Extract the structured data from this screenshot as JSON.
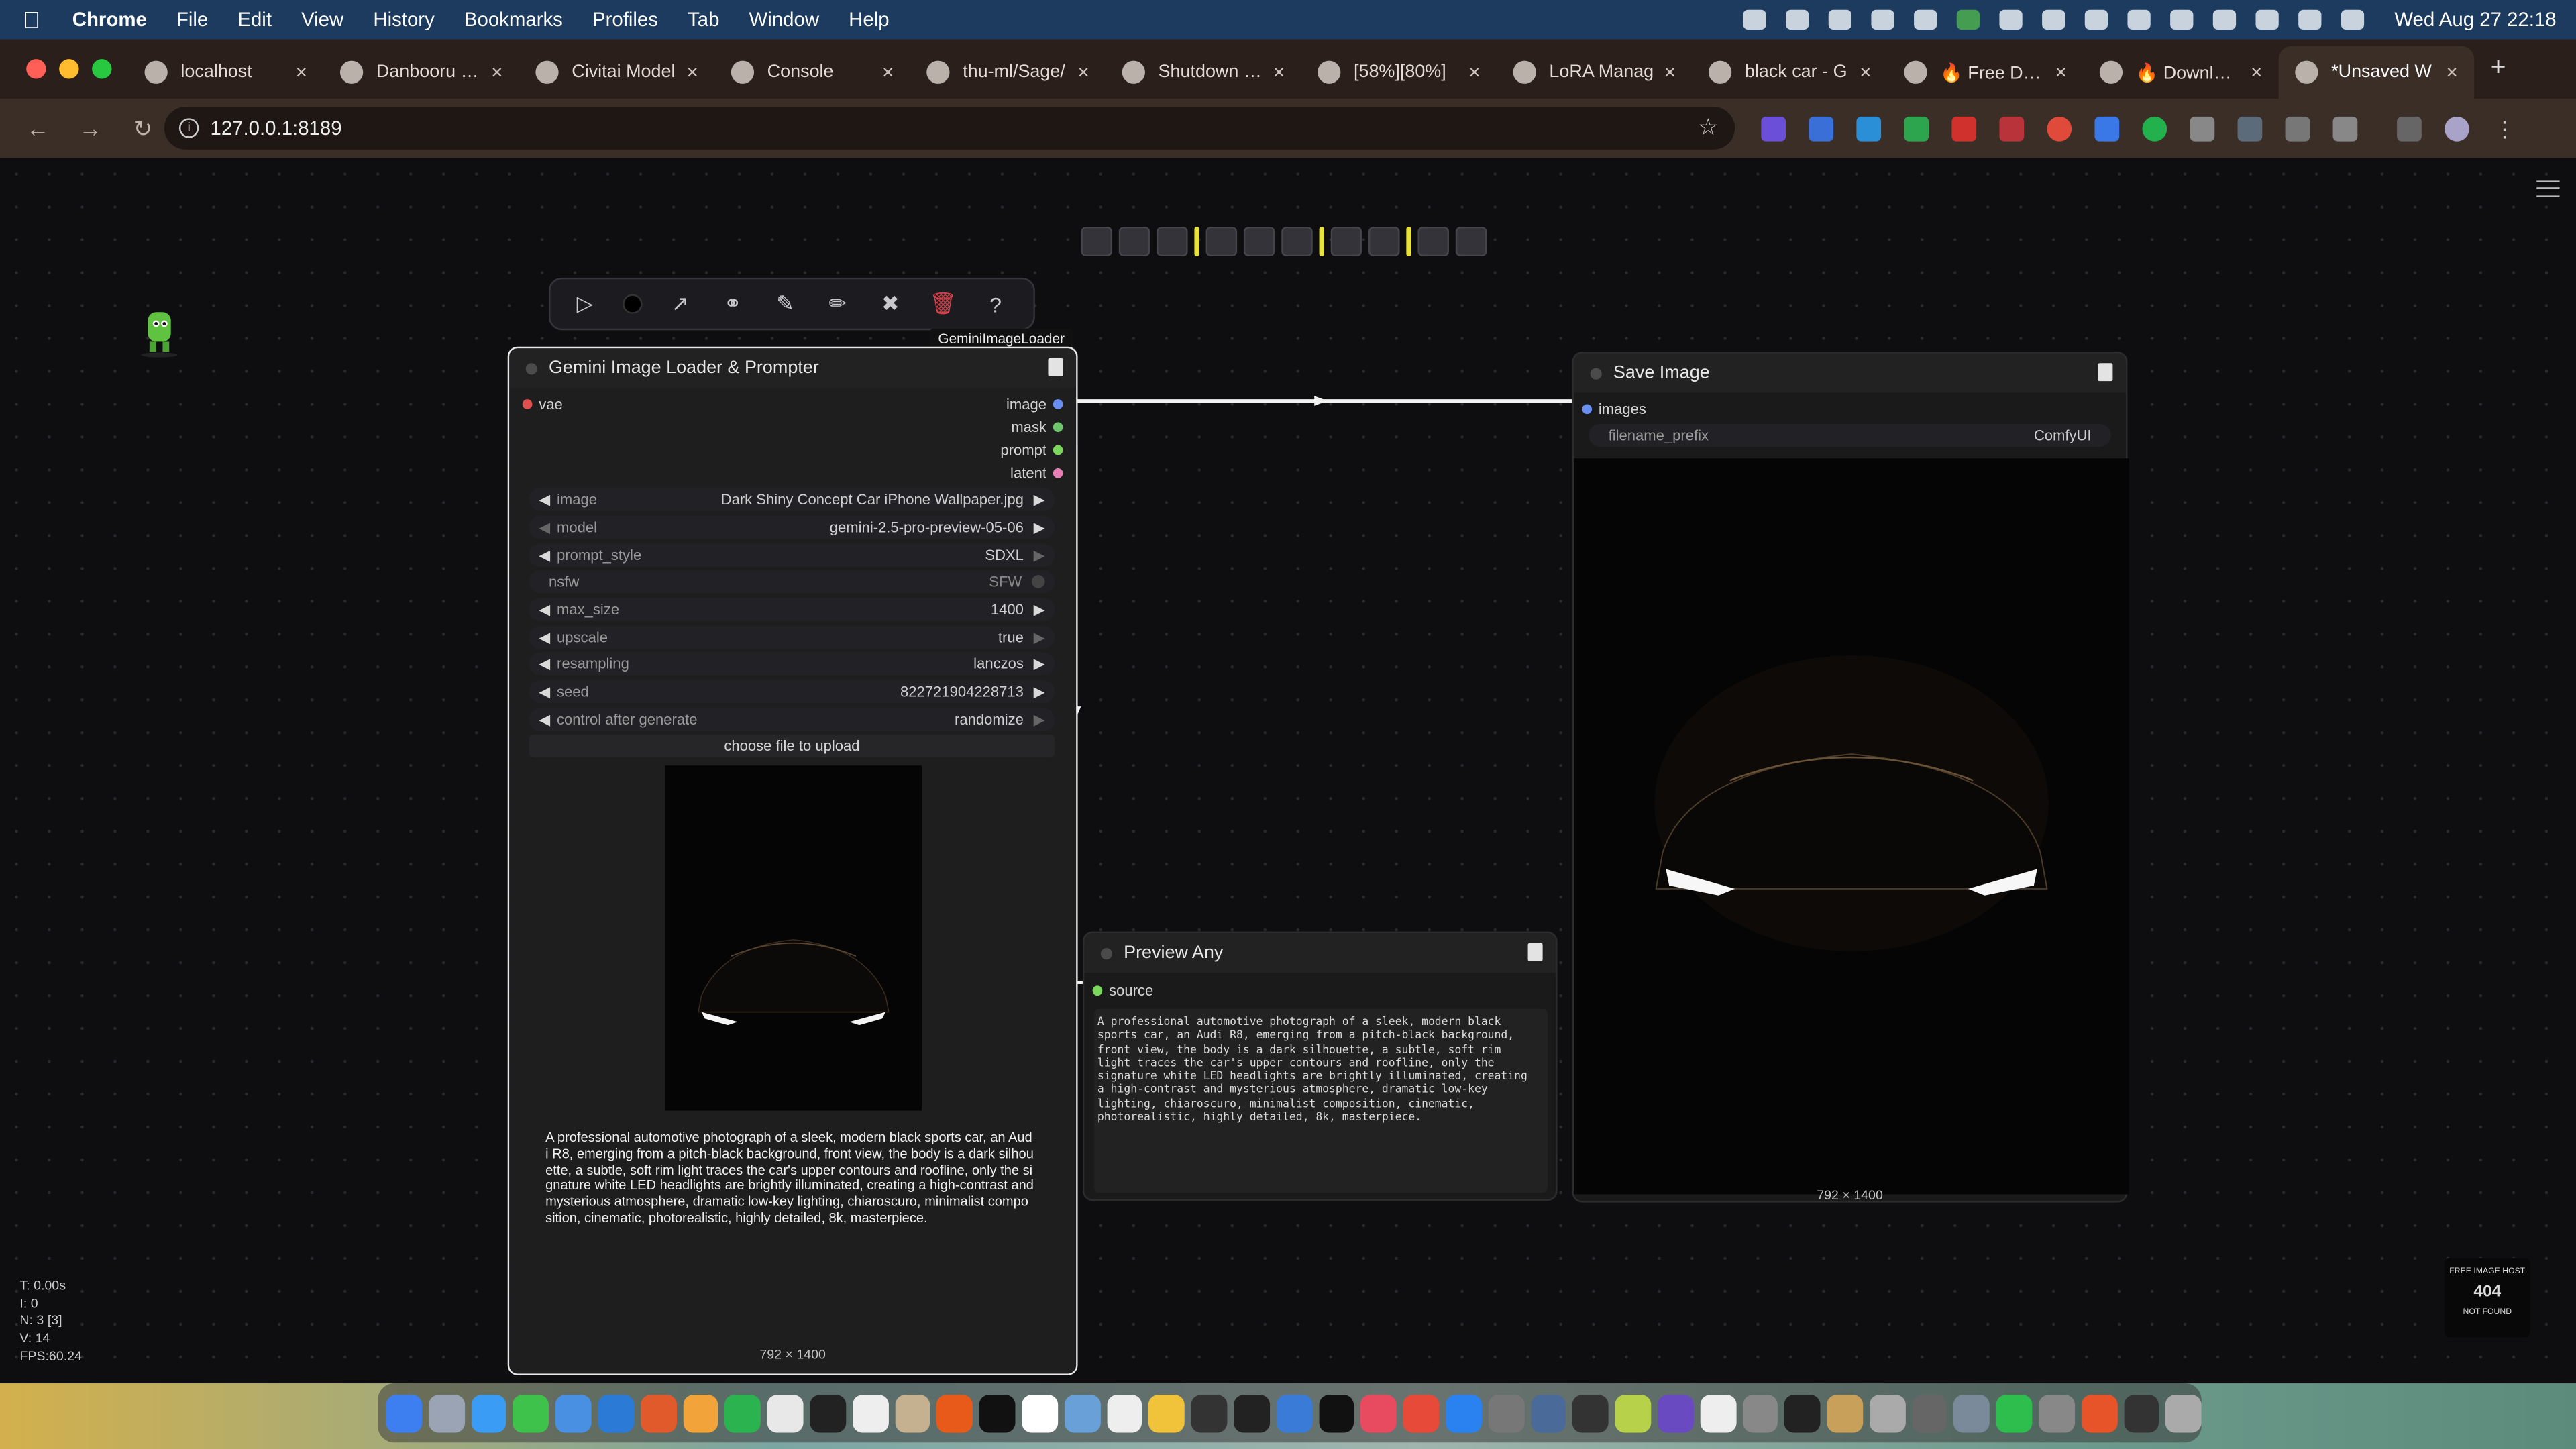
{
  "menubar": {
    "app": "Chrome",
    "items": [
      "File",
      "Edit",
      "View",
      "History",
      "Bookmarks",
      "Profiles",
      "Tab",
      "Window",
      "Help"
    ],
    "clock": "Wed Aug 27  22:18"
  },
  "tabs": [
    {
      "title": "localhost",
      "fav": "globe-icon"
    },
    {
      "title": "Danbooru Po",
      "fav": "danbooru-icon"
    },
    {
      "title": "Civitai Model",
      "fav": "civitai-icon"
    },
    {
      "title": "Console",
      "fav": "n-icon"
    },
    {
      "title": "thu-ml/Sage/",
      "fav": "github-icon"
    },
    {
      "title": "Shutdown bo",
      "fav": "openai-icon"
    },
    {
      "title": "[58%][80%]",
      "fav": "comfy-icon"
    },
    {
      "title": "LoRA Manag",
      "fav": "l-icon"
    },
    {
      "title": "black car - G",
      "fav": "google-icon"
    },
    {
      "title": "🔥 Free Dow",
      "fav": "firefox-icon"
    },
    {
      "title": "🔥 Download",
      "fav": "firefox-icon"
    },
    {
      "title": "*Unsaved W",
      "fav": "comfy-icon",
      "active": true
    }
  ],
  "address": {
    "url": "127.0.0.1:8189"
  },
  "selection_badge": "GeminiImageLoader",
  "nodes": {
    "gemini": {
      "title": "Gemini Image Loader & Prompter",
      "input": "vae",
      "outputs": [
        "image",
        "mask",
        "prompt",
        "latent"
      ],
      "widgets": [
        {
          "name": "image",
          "value": "Dark Shiny Concept Car iPhone Wallpaper.jpg",
          "dim": false
        },
        {
          "name": "model",
          "value": "gemini-2.5-pro-preview-05-06",
          "dim": true
        },
        {
          "name": "prompt_style",
          "value": "SDXL",
          "dim": false
        },
        {
          "name": "nsfw",
          "value": "SFW",
          "dim": true,
          "toggle": true
        },
        {
          "name": "max_size",
          "value": "1400",
          "dim": false
        },
        {
          "name": "upscale",
          "value": "true",
          "dim": false
        },
        {
          "name": "resampling",
          "value": "lanczos",
          "dim": false
        },
        {
          "name": "seed",
          "value": "822721904228713",
          "dim": false
        },
        {
          "name": "control after generate",
          "value": "randomize",
          "dim": false
        }
      ],
      "upload_button": "choose file to upload",
      "prompt_text": "A professional automotive photograph of a sleek, modern black sports car, an Audi R8, emerging from a pitch-black background, front view, the body is a dark silhouette, a subtle, soft rim light traces the car's upper contours and roofline, only the signature white LED headlights are brightly illuminated, creating a high-contrast and mysterious atmosphere, dramatic low-key lighting, chiaroscuro, minimalist composition, cinematic, photorealistic, highly detailed, 8k, masterpiece.",
      "dims": "792 × 1400"
    },
    "save": {
      "title": "Save Image",
      "input": "images",
      "widget": {
        "name": "filename_prefix",
        "value": "ComfyUI"
      },
      "dims": "792 × 1400"
    },
    "preview": {
      "title": "Preview Any",
      "input": "source",
      "text": "A professional automotive photograph of a sleek, modern black\nsports car, an Audi R8, emerging from a pitch-black background,\nfront view, the body is a dark silhouette, a subtle, soft rim\nlight traces the car's upper contours and roofline, only the\nsignature white LED headlights are brightly illuminated, creating\na high-contrast and mysterious atmosphere, dramatic low-key\nlighting, chiaroscuro, minimalist composition, cinematic,\nphotorealistic, highly detailed, 8k, masterpiece."
    }
  },
  "stats": {
    "t": "T: 0.00s",
    "i": "I: 0",
    "n": "N: 3 [3]",
    "v": "V: 14",
    "fps": "FPS:60.24"
  },
  "badge": {
    "line1": "FREE IMAGE HOST",
    "code": "404",
    "line2": "NOT FOUND"
  },
  "colors": {
    "link_image": "#6a8df0",
    "link_prompt": "#7bd85c",
    "link_mask": "#6ec56e",
    "link_latent": "#e87fb6",
    "vae": "#e05050",
    "accent_yellow": "#e8e23a"
  }
}
